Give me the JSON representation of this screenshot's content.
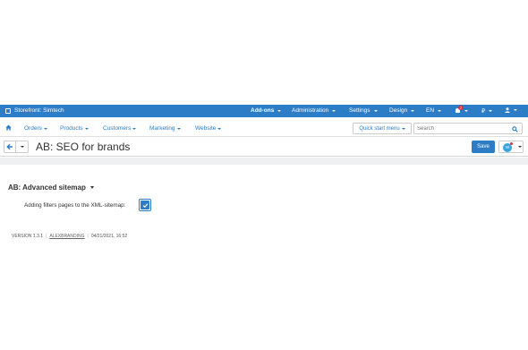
{
  "topbar": {
    "storefront": "Storefront: Simtech",
    "addons": "Add-ons",
    "administration": "Administration",
    "settings": "Settings",
    "design": "Design",
    "language": "EN",
    "notifications_count": "2",
    "currency": "₽"
  },
  "navbar": {
    "orders": "Orders",
    "products": "Products",
    "customers": "Customers",
    "marketing": "Marketing",
    "website": "Website",
    "quick_start": "Quick start menu",
    "search_placeholder": "Search"
  },
  "title": {
    "text": "AB: SEO for brands",
    "save": "Save"
  },
  "section": {
    "heading": "AB: Advanced sitemap",
    "field_label": "Adding filters pages to the XML-sitemap:",
    "checkbox_checked": true
  },
  "footer": {
    "version": "VERSION 1.3.1",
    "vendor": "ALEXBRANDING",
    "date": "04/21/2021, 16:52"
  },
  "colors": {
    "accent": "#2d7cc6",
    "badge": "#d9313e"
  }
}
